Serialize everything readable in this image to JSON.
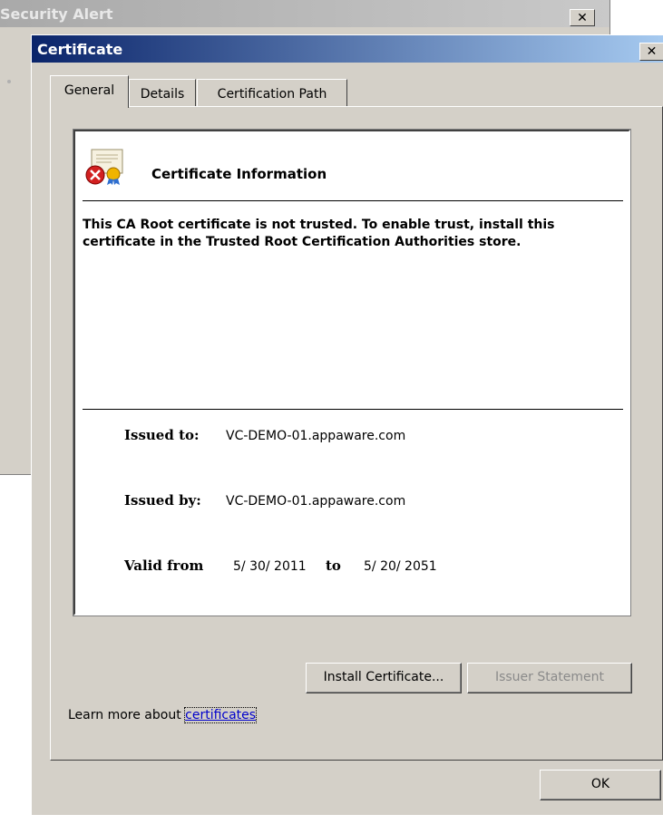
{
  "background_window": {
    "title": "Security Alert",
    "close_glyph": "✕"
  },
  "dialog": {
    "title": "Certificate",
    "close_glyph": "✕"
  },
  "tabs": [
    {
      "label": "General",
      "selected": true
    },
    {
      "label": "Details",
      "selected": false
    },
    {
      "label": "Certification Path",
      "selected": false
    }
  ],
  "info": {
    "icon": "certificate-error-icon",
    "heading": "Certificate Information",
    "message": "This CA Root certificate is not trusted. To enable trust, install this certificate in the Trusted Root Certification Authorities store.",
    "issued_to_label": "Issued to:",
    "issued_to_value": "VC-DEMO-01.appaware.com",
    "issued_by_label": "Issued by:",
    "issued_by_value": "VC-DEMO-01.appaware.com",
    "valid_from_label": "Valid from",
    "valid_from_value": "5/ 30/ 2011",
    "valid_to_label": "to",
    "valid_to_value": "5/ 20/ 2051"
  },
  "buttons": {
    "install": "Install Certificate...",
    "issuer": "Issuer Statement",
    "ok": "OK"
  },
  "learn_more": {
    "prefix": "Learn more about ",
    "link": "certificates"
  },
  "colors": {
    "titlebar_active": "#0a246a",
    "dialog_bg": "#d4d0c8",
    "link": "#0000cc",
    "disabled_text": "#8a8a8a"
  }
}
